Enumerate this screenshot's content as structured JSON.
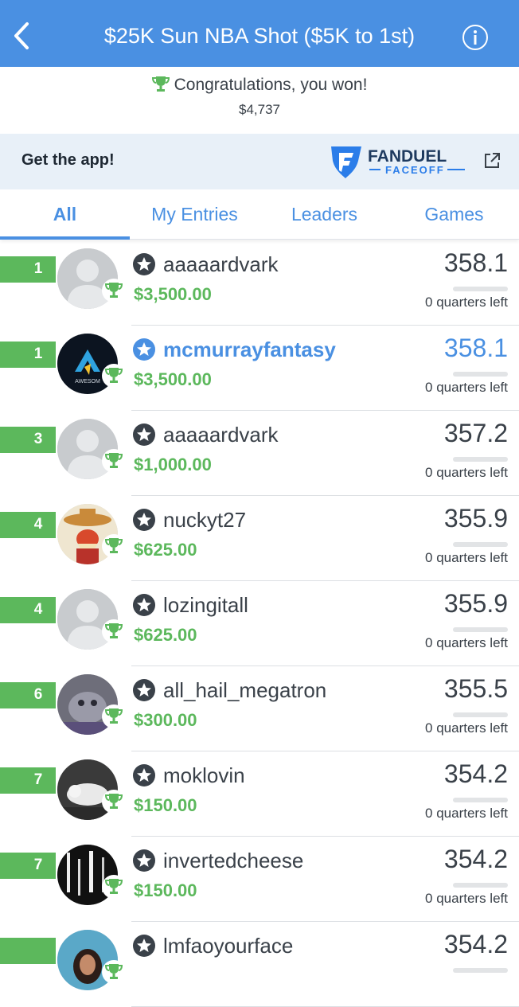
{
  "header": {
    "title": "$25K Sun NBA Shot ($5K to 1st)"
  },
  "congrats": {
    "message": "Congratulations, you won!",
    "amount": "$4,737"
  },
  "promo": {
    "label": "Get the app!",
    "brand": "FANDUEL",
    "sub": "FACEOFF"
  },
  "tabs": [
    {
      "label": "All",
      "active": true
    },
    {
      "label": "My Entries"
    },
    {
      "label": "Leaders"
    },
    {
      "label": "Games"
    }
  ],
  "colors": {
    "primary": "#4a90e2",
    "win": "#5cb85c",
    "text": "#3a4149"
  },
  "entries": [
    {
      "rank": "1",
      "name": "aaaaardvark",
      "prize": "$3,500.00",
      "score": "358.1",
      "left": "0 quarters left",
      "avatar": "default"
    },
    {
      "rank": "1",
      "name": "mcmurrayfantasy",
      "prize": "$3,500.00",
      "score": "358.1",
      "left": "0 quarters left",
      "avatar": "awesome",
      "me": true
    },
    {
      "rank": "3",
      "name": "aaaaardvark",
      "prize": "$1,000.00",
      "score": "357.2",
      "left": "0 quarters left",
      "avatar": "default"
    },
    {
      "rank": "4",
      "name": "nuckyt27",
      "prize": "$625.00",
      "score": "355.9",
      "left": "0 quarters left",
      "avatar": "cartoon"
    },
    {
      "rank": "4",
      "name": "lozingitall",
      "prize": "$625.00",
      "score": "355.9",
      "left": "0 quarters left",
      "avatar": "default"
    },
    {
      "rank": "6",
      "name": "all_hail_megatron",
      "prize": "$300.00",
      "score": "355.5",
      "left": "0 quarters left",
      "avatar": "cat"
    },
    {
      "rank": "7",
      "name": "moklovin",
      "prize": "$150.00",
      "score": "354.2",
      "left": "0 quarters left",
      "avatar": "dog"
    },
    {
      "rank": "7",
      "name": "invertedcheese",
      "prize": "$150.00",
      "score": "354.2",
      "left": "0 quarters left",
      "avatar": "dark"
    },
    {
      "rank": "",
      "name": "lmfaoyourface",
      "prize": "",
      "score": "354.2",
      "left": "",
      "avatar": "photo"
    }
  ]
}
